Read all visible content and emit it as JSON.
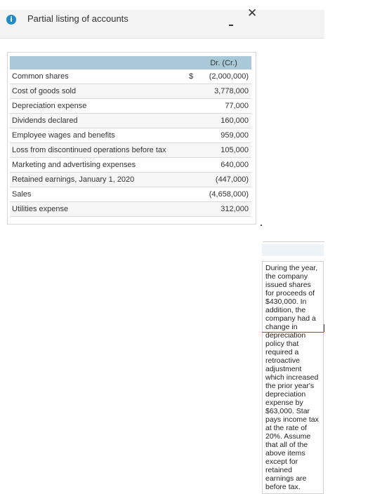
{
  "window": {
    "title": "Partial listing of accounts",
    "close_glyph": "✕",
    "info_glyph": "i"
  },
  "table": {
    "header": {
      "amount": "Dr. (Cr.)"
    },
    "rows": [
      {
        "account": "Common shares",
        "currency": "$",
        "amount": "(2,000,000)"
      },
      {
        "account": "Cost of goods sold",
        "currency": "",
        "amount": "3,778,000"
      },
      {
        "account": "Depreciation expense",
        "currency": "",
        "amount": "77,000"
      },
      {
        "account": "Dividends declared",
        "currency": "",
        "amount": "160,000"
      },
      {
        "account": "Employee wages and benefits",
        "currency": "",
        "amount": "959,000"
      },
      {
        "account": "Loss from discontinued operations before tax",
        "currency": "",
        "amount": "105,000"
      },
      {
        "account": "Marketing and advertising expenses",
        "currency": "",
        "amount": "640,000"
      },
      {
        "account": "Retained earnings, January 1, 2020",
        "currency": "",
        "amount": "(447,000)"
      },
      {
        "account": "Sales",
        "currency": "",
        "amount": "(4,658,000)"
      },
      {
        "account": "Utilities expense",
        "currency": "",
        "amount": "312,000"
      }
    ]
  },
  "note": "During the year, the company issued shares for proceeds of $430,000. In addition, the company had a change in depreciation policy that required a retroactive adjustment which increased the prior year's depreciation expense by $63,000. Star pays income tax at the rate of 20%. Assume that all of the above items except for retained earnings are before tax."
}
